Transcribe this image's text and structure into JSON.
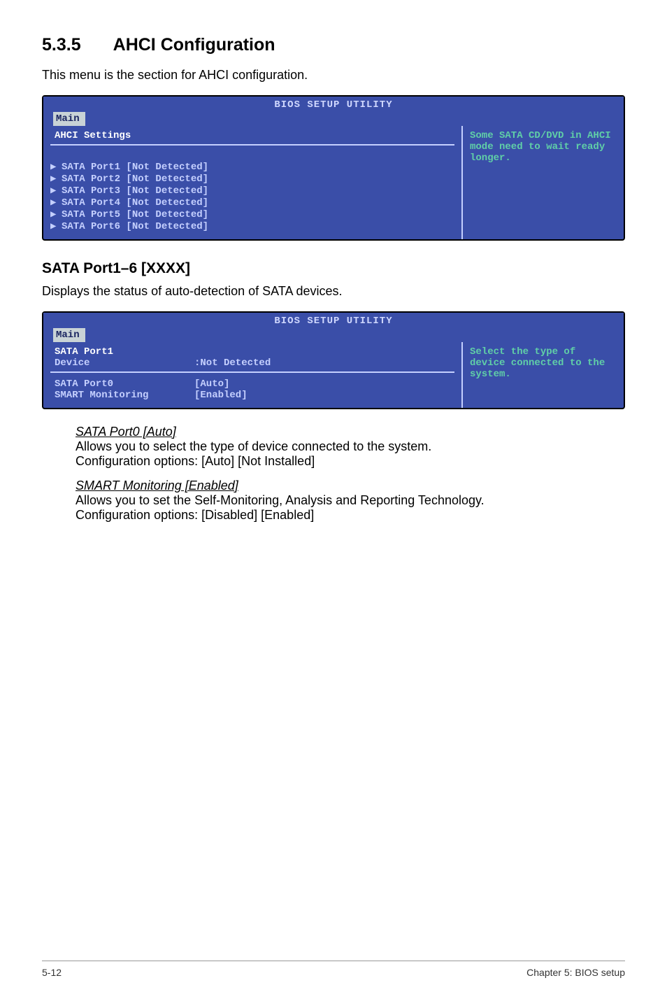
{
  "heading": {
    "number": "5.3.5",
    "title": "AHCI Configuration"
  },
  "intro": "This menu is the section for AHCI configuration.",
  "bios1": {
    "header": "BIOS SETUP UTILITY",
    "tab": "Main",
    "panel_title": "AHCI Settings",
    "items": [
      "SATA Port1 [Not Detected]",
      "SATA Port2 [Not Detected]",
      "SATA Port3 [Not Detected]",
      "SATA Port4 [Not Detected]",
      "SATA Port5 [Not Detected]",
      "SATA Port6 [Not Detected]"
    ],
    "help": "Some SATA CD/DVD in AHCI mode need to wait ready longer."
  },
  "subheading": "SATA Port1–6 [XXXX]",
  "subintro": "Displays the status of auto-detection of SATA devices.",
  "bios2": {
    "header": "BIOS SETUP UTILITY",
    "tab": "Main",
    "panel_title": "SATA Port1",
    "device_label": "Device",
    "device_value": ":Not Detected",
    "rows": [
      {
        "label": "SATA Port0",
        "value": "[Auto]"
      },
      {
        "label": "SMART Monitoring",
        "value": "[Enabled]"
      }
    ],
    "help": "Select the type of device connected to the system."
  },
  "sata_port0": {
    "title": "SATA Port0 [Auto]",
    "line1": "Allows you to select the type of device connected to the system.",
    "line2": "Configuration options: [Auto] [Not Installed]"
  },
  "smart": {
    "title": "SMART Monitoring [Enabled]",
    "line1": "Allows you to set the Self-Monitoring, Analysis and Reporting Technology.",
    "line2": "Configuration options: [Disabled] [Enabled]"
  },
  "footer": {
    "left": "5-12",
    "right": "Chapter 5: BIOS setup"
  }
}
